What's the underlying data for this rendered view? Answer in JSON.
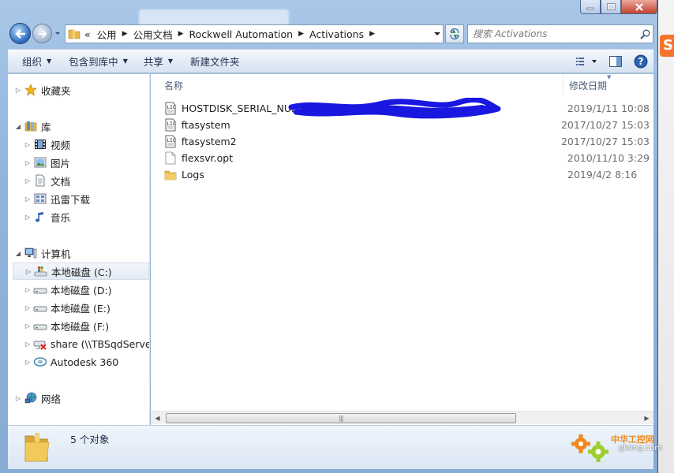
{
  "window": {
    "caption_buttons": [
      "minimize",
      "maximize",
      "close"
    ]
  },
  "nav": {
    "breadcrumb_prefix": "«",
    "breadcrumbs": [
      "公用",
      "公用文档",
      "Rockwell Automation",
      "Activations"
    ],
    "search_placeholder": "搜索 Activations"
  },
  "toolbar": {
    "organize": "组织",
    "include_in_library": "包含到库中",
    "share": "共享",
    "new_folder": "新建文件夹"
  },
  "sidebar": {
    "favorites": "收藏夹",
    "libraries": "库",
    "library_items": [
      "视频",
      "图片",
      "文档",
      "迅雷下载",
      "音乐"
    ],
    "computer": "计算机",
    "computer_items": [
      "本地磁盘 (C:)",
      "本地磁盘 (D:)",
      "本地磁盘 (E:)",
      "本地磁盘 (F:)",
      "share (\\\\TBSqdServer.",
      "Autodesk 360"
    ],
    "network": "网络"
  },
  "columns": {
    "name": "名称",
    "date_modified": "修改日期"
  },
  "files": [
    {
      "name": "HOSTDISK_SERIAL_NUM=",
      "date": "2019/1/11 10:08",
      "icon": "license-file-icon"
    },
    {
      "name": "ftasystem",
      "date": "2017/10/27 15:03",
      "icon": "license-file-icon"
    },
    {
      "name": "ftasystem2",
      "date": "2017/10/27 15:03",
      "icon": "license-file-icon"
    },
    {
      "name": "flexsvr.opt",
      "date": "2010/11/10 3:29",
      "icon": "blank-file-icon"
    },
    {
      "name": "Logs",
      "date": "2019/4/2 8:16",
      "icon": "folder-icon"
    }
  ],
  "status": {
    "count": "5 个对象"
  },
  "watermark": {
    "cn": "中华工控网",
    "en": "gkong.com"
  },
  "colors": {
    "frame": "#8fb4dd",
    "accent_blue": "#2f6fc0",
    "redaction": "#1a17e0",
    "folder": "#e8b84a"
  }
}
